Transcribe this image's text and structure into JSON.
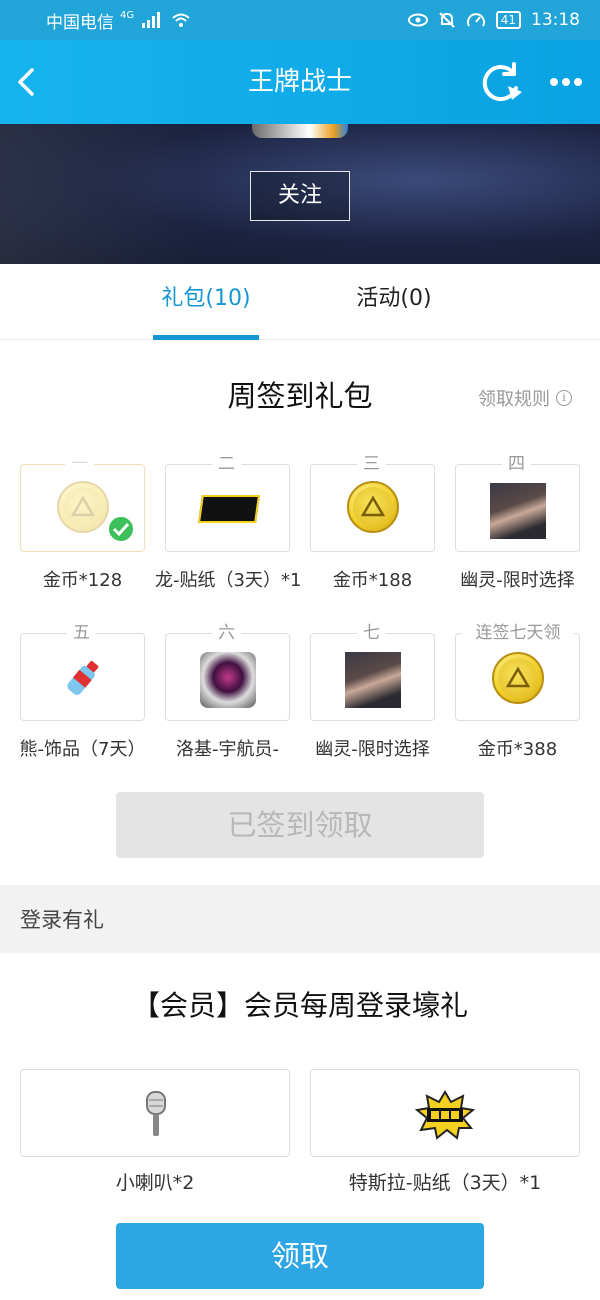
{
  "status_bar": {
    "carrier": "中国电信",
    "network": "4G",
    "battery": "41",
    "time": "13:18"
  },
  "header": {
    "title": "王牌战士",
    "back_icon": "chevron-left-icon",
    "refresh_icon": "refresh-icon",
    "more_icon": "more-icon"
  },
  "banner": {
    "follow_label": "关注"
  },
  "tabs": [
    {
      "label": "礼包(10)",
      "active": true
    },
    {
      "label": "活动(0)",
      "active": false
    }
  ],
  "weekly": {
    "title": "周签到礼包",
    "rule_link": "领取规则",
    "days": [
      {
        "day": "一",
        "name": "金币*128",
        "item": "coin",
        "checked": true
      },
      {
        "day": "二",
        "name": "龙-贴纸（3天）*1",
        "item": "sticker"
      },
      {
        "day": "三",
        "name": "金币*188",
        "item": "coin"
      },
      {
        "day": "四",
        "name": "幽灵-限时选择",
        "item": "portrait"
      },
      {
        "day": "五",
        "name": "熊-饰品（7天）",
        "item": "bottle"
      },
      {
        "day": "六",
        "name": "洛基-宇航员-",
        "item": "astronaut"
      },
      {
        "day": "七",
        "name": "幽灵-限时选择",
        "item": "portrait"
      },
      {
        "day": "连签七天领",
        "name": "金币*388",
        "item": "coin"
      }
    ],
    "claimed_button": "已签到领取"
  },
  "login_section": {
    "header": "登录有礼",
    "title": "【会员】会员每周登录壕礼",
    "items": [
      {
        "name": "小喇叭*2",
        "item": "microphone"
      },
      {
        "name": "特斯拉-贴纸（3天）*1",
        "item": "sticker"
      }
    ],
    "claim_button": "领取"
  },
  "colors": {
    "accent": "#1696d2",
    "header_bg": "#16b4ef",
    "claim_button": "#2ea6e4",
    "checked_badge": "#3cc05a"
  }
}
